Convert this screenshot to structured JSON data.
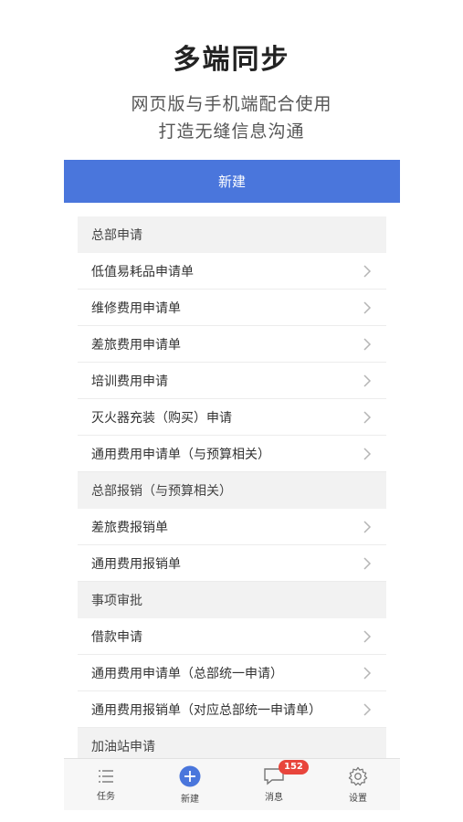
{
  "hero": {
    "title": "多端同步",
    "subtitle_line1": "网页版与手机端配合使用",
    "subtitle_line2": "打造无缝信息沟通"
  },
  "header": {
    "title": "新建"
  },
  "sections": [
    {
      "title": "总部申请",
      "items": [
        {
          "label": "低值易耗品申请单"
        },
        {
          "label": "维修费用申请单"
        },
        {
          "label": "差旅费用申请单"
        },
        {
          "label": "培训费用申请"
        },
        {
          "label": "灭火器充装（购买）申请"
        },
        {
          "label": "通用费用申请单（与预算相关）"
        }
      ]
    },
    {
      "title": "总部报销（与预算相关）",
      "items": [
        {
          "label": "差旅费报销单"
        },
        {
          "label": "通用费用报销单"
        }
      ]
    },
    {
      "title": "事项审批",
      "items": [
        {
          "label": "借款申请"
        },
        {
          "label": "通用费用申请单（总部统一申请）"
        },
        {
          "label": "通用费用报销单（对应总部统一申请单）"
        }
      ]
    },
    {
      "title": "加油站申请",
      "items": []
    }
  ],
  "tabbar": {
    "tasks": "任务",
    "new": "新建",
    "messages": "消息",
    "messages_badge": "152",
    "settings": "设置"
  },
  "colors": {
    "accent": "#4a76dc",
    "badge": "#e8453c"
  }
}
